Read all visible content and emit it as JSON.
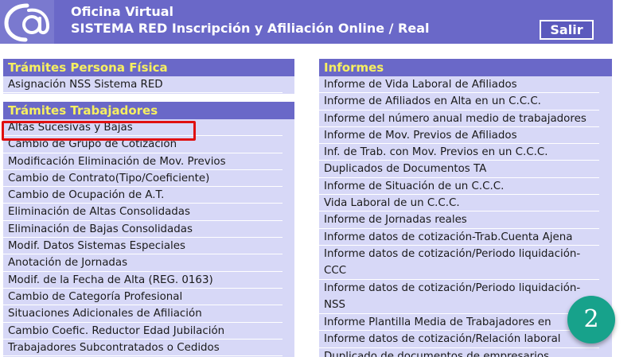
{
  "header": {
    "title": "Oficina Virtual",
    "subtitle": "SISTEMA RED Inscripción y Afiliación Online / Real",
    "logout_label": "Salir",
    "logo_icon": "at-sign-logo-icon"
  },
  "persona_fisica": {
    "heading": "Trámites Persona Física",
    "items": [
      "Asignación NSS Sistema RED"
    ]
  },
  "trabajadores": {
    "heading": "Trámites Trabajadores",
    "items": [
      "Altas Sucesivas y Bajas",
      "Cambio de Grupo de Cotización",
      "Modificación Eliminación de Mov. Previos",
      "Cambio de Contrato(Tipo/Coeficiente)",
      "Cambio de Ocupación de A.T.",
      "Eliminación de Altas Consolidadas",
      "Eliminación de Bajas Consolidadas",
      "Modif. Datos Sistemas Especiales",
      "Anotación de Jornadas",
      "Modif. de la Fecha de Alta (REG. 0163)",
      "Cambio de Categoría Profesional",
      "Situaciones Adicionales de Afiliación",
      "Cambio Coefic. Reductor Edad Jubilación",
      "Trabajadores Subcontratados o Cedidos"
    ]
  },
  "informes": {
    "heading": "Informes",
    "items": [
      "Informe de Vida Laboral de Afiliados",
      "Informe de Afiliados en Alta en un C.C.C.",
      "Informe del número anual medio de trabajadores",
      "Informe de Mov. Previos de Afiliados",
      "Inf. de Trab. con Mov. Previos en un C.C.C.",
      "Duplicados de Documentos TA",
      "Informe de Situación de un C.C.C.",
      "Vida Laboral de un C.C.C.",
      "Informe de Jornadas reales",
      "Informe datos de cotización-Trab.Cuenta Ajena",
      "Informe datos de cotización/Periodo liquidación-CCC",
      "Informe datos de cotización/Periodo liquidación-NSS",
      "Informe Plantilla Media de Trabajadores en",
      "Informe datos de cotización/Relación laboral",
      "Duplicado de documentos de empresarios"
    ]
  },
  "step_badge": "2",
  "colors": {
    "header_bg": "#6a68c8",
    "panel_bg": "#d7d8f7",
    "heading_text": "#f7f060",
    "highlight": "#e01010",
    "badge": "#17a28b"
  }
}
